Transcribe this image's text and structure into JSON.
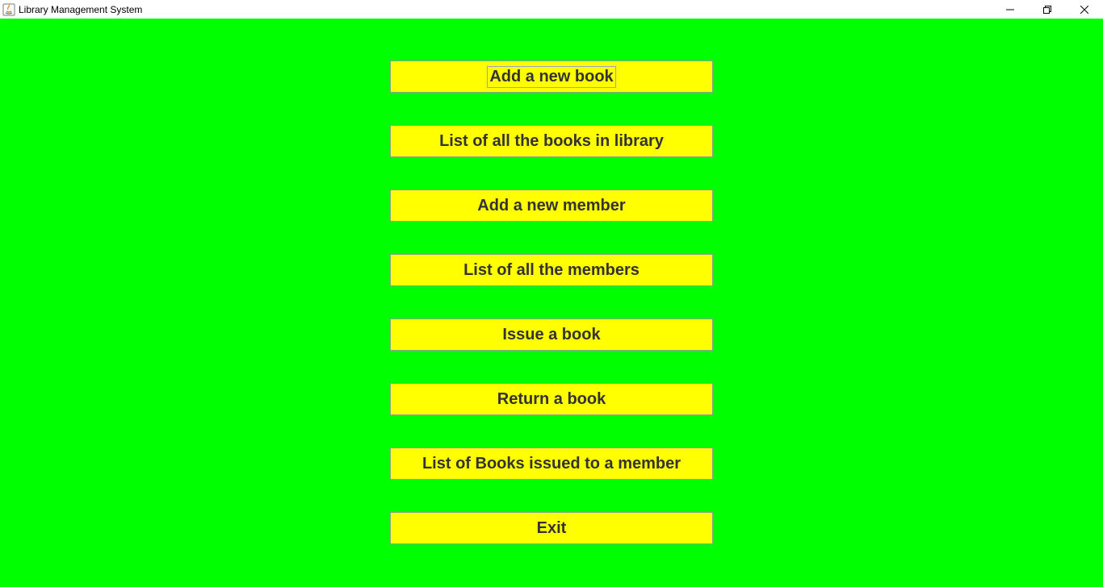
{
  "window": {
    "title": "Library Management System",
    "background_color": "#00ff00"
  },
  "titlebar": {
    "icon": "java-app-icon",
    "controls": [
      "minimize-icon",
      "restore-icon",
      "close-icon"
    ]
  },
  "menu": {
    "button_color": "#ffff00",
    "focused_index": 0,
    "buttons": [
      {
        "label": "Add a new book"
      },
      {
        "label": "List of all the books in library"
      },
      {
        "label": "Add a new member"
      },
      {
        "label": "List of all the members"
      },
      {
        "label": "Issue a book"
      },
      {
        "label": "Return a book"
      },
      {
        "label": "List of Books issued to a member"
      },
      {
        "label": "Exit"
      }
    ]
  }
}
